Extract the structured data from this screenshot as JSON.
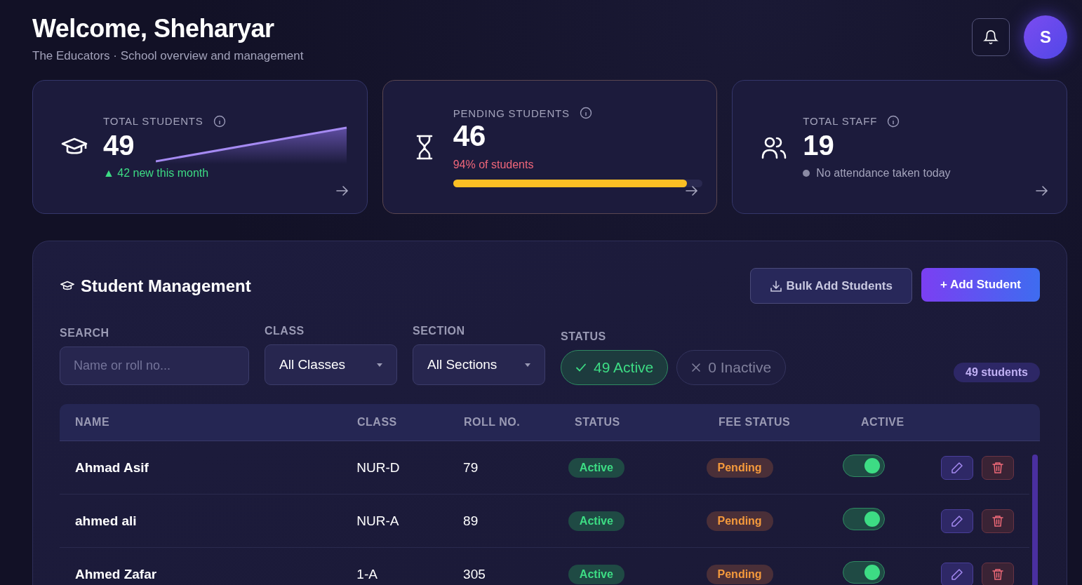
{
  "header": {
    "title": "Welcome, Sheharyar",
    "subtitle": "The Educators · School overview and management",
    "avatar": "S"
  },
  "stats": [
    {
      "kind": "trend",
      "label": "TOTAL STUDENTS",
      "value": "49",
      "note": "▲ 42 new this month"
    },
    {
      "kind": "progress",
      "label": "PENDING STUDENTS",
      "value": "46",
      "note": "94% of students",
      "level": 0.94
    },
    {
      "kind": "dot",
      "label": "TOTAL STAFF",
      "value": "19",
      "note": "No attendance taken today"
    }
  ],
  "panel": {
    "title": "Student Management",
    "bulk_button": "Bulk Add Students",
    "add_button": "+ Add Student",
    "filters": {
      "search": {
        "label": "SEARCH",
        "placeholder": "Name or roll no..."
      },
      "class": {
        "label": "CLASS",
        "value": "All Classes"
      },
      "section": {
        "label": "SECTION",
        "value": "All Sections"
      },
      "status": {
        "label": "STATUS",
        "options": [
          {
            "kind": "check",
            "label": "49 Active",
            "selected": true
          },
          {
            "kind": "cross",
            "label": "0 Inactive",
            "selected": false
          }
        ]
      }
    },
    "count": "49 students",
    "table": {
      "columns": [
        "NAME",
        "CLASS",
        "ROLL NO.",
        "STATUS",
        "FEE STATUS",
        "ACTIVE"
      ],
      "rows": [
        {
          "name": "Ahmad Asif",
          "class": "NUR-D",
          "roll": "79",
          "status": "Active",
          "fee": "Pending",
          "on": true
        },
        {
          "name": "ahmed ali",
          "class": "NUR-A",
          "roll": "89",
          "status": "Active",
          "fee": "Pending",
          "on": true
        },
        {
          "name": "Ahmed Zafar",
          "class": "1-A",
          "roll": "305",
          "status": "Active",
          "fee": "Pending",
          "on": true
        }
      ]
    }
  }
}
